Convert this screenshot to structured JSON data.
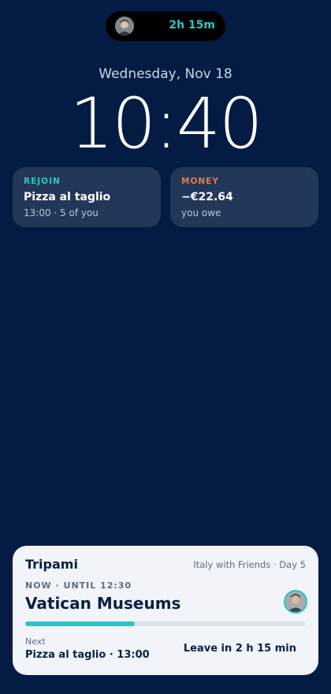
{
  "island": {
    "timer": "2h 15m",
    "avatar_icon": "person-avatar-icon"
  },
  "lock": {
    "date": "Wednesday, Nov 18",
    "time": "10:40"
  },
  "widgets": [
    {
      "tag": "REJOIN",
      "tag_color": "#2ec4c4",
      "main": "Pizza al taglio",
      "sub": "13:00 · 5 of you"
    },
    {
      "tag": "MONEY",
      "tag_color": "#e8794f",
      "main": "−€22.64",
      "sub": "you owe"
    }
  ],
  "card": {
    "brand": "Tripami",
    "trip": "Italy with Friends · Day 5",
    "now_label": "NOW · UNTIL 12:30",
    "title": "Vatican Museums",
    "progress": 0.39,
    "next_label": "Next",
    "next_value": "Pizza al taglio · 13:00",
    "leave": "Leave in 2 h 15 min",
    "accent": "#2ec4c4"
  }
}
